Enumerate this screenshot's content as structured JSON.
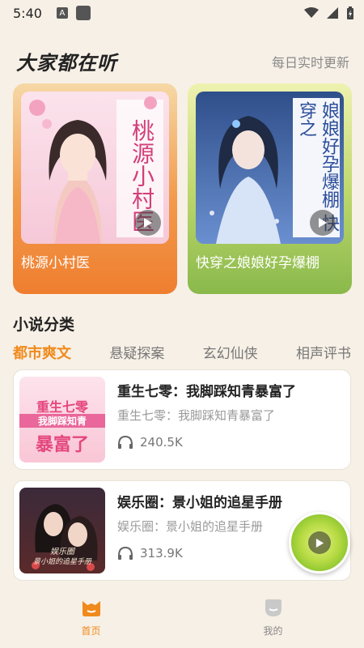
{
  "status_bar": {
    "time": "5:40",
    "notif_letter": "A"
  },
  "header": {
    "title": "大家都在听",
    "link": "每日实时更新"
  },
  "featured": [
    {
      "title": "桃源小村医",
      "cover_text": "桃源小村医"
    },
    {
      "title": "快穿之娘娘好孕爆棚",
      "cover_text": "娘娘好孕爆棚 快穿之"
    }
  ],
  "categories": {
    "title": "小说分类",
    "tabs": [
      "都市爽文",
      "悬疑探案",
      "玄幻仙侠",
      "相声评书"
    ],
    "active_tab": 0
  },
  "books": [
    {
      "title": "重生七零：我脚踩知青暴富了",
      "subtitle": "重生七零：我脚踩知青暴富了",
      "plays": "240.5K",
      "cover_text_1": "重生七零",
      "cover_text_2": "我脚踩知青",
      "cover_text_3": "暴富了"
    },
    {
      "title": "娱乐圈：景小姐的追星手册",
      "subtitle": "娱乐圈：景小姐的追星手册",
      "plays": "313.9K",
      "cover_text_1": "娱乐圈",
      "cover_text_2": "景小姐的追星手册"
    }
  ],
  "nav": {
    "home": "首页",
    "mine": "我的"
  },
  "colors": {
    "accent": "#f08a1c",
    "background": "#f7f0e6"
  }
}
